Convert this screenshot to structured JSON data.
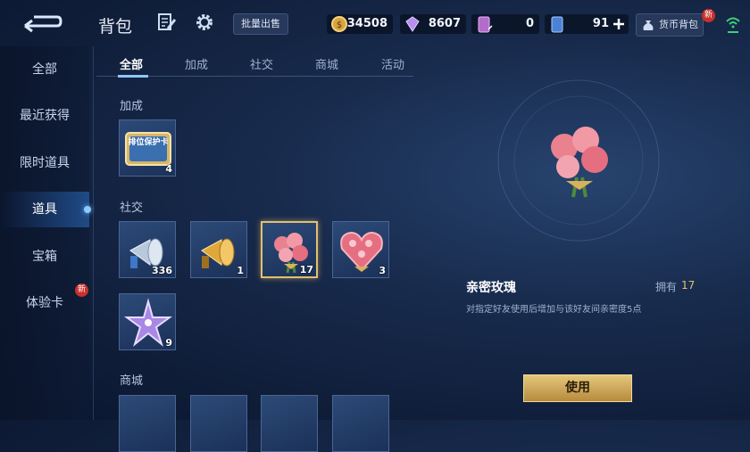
{
  "header": {
    "title": "背包",
    "batch_sell_label": "批量出售",
    "currencies": [
      {
        "icon": "gold-coin-icon",
        "value": "34508"
      },
      {
        "icon": "diamond-icon",
        "value": "8607"
      },
      {
        "icon": "ticket-card-icon",
        "value": "0"
      },
      {
        "icon": "voucher-card-icon",
        "value": "91"
      }
    ],
    "wallet_label": "货币背包",
    "wallet_badge": "新"
  },
  "sidebar": {
    "items": [
      {
        "label": "全部"
      },
      {
        "label": "最近获得"
      },
      {
        "label": "限时道具"
      },
      {
        "label": "道具"
      },
      {
        "label": "宝箱"
      },
      {
        "label": "体验卡",
        "badge": "新"
      }
    ],
    "active_index": 3
  },
  "tabs": [
    {
      "label": "全部"
    },
    {
      "label": "加成"
    },
    {
      "label": "社交"
    },
    {
      "label": "商城"
    },
    {
      "label": "活动"
    }
  ],
  "sections": [
    {
      "title": "加成",
      "items": [
        {
          "name": "ranking-protection-card",
          "icon_text": "排位保护卡",
          "count": "4"
        }
      ]
    },
    {
      "title": "社交",
      "items": [
        {
          "name": "silver-megaphone",
          "count": "336"
        },
        {
          "name": "gold-megaphone",
          "count": "1"
        },
        {
          "name": "intimate-rose",
          "count": "17"
        },
        {
          "name": "heart-roses",
          "count": "3"
        },
        {
          "name": "purple-star",
          "count": "9"
        }
      ]
    },
    {
      "title": "商城"
    }
  ],
  "detail": {
    "name": "亲密玫瑰",
    "owned_label": "拥有",
    "owned_value": "17",
    "description": "对指定好友使用后增加与该好友间亲密度5点",
    "use_label": "使用"
  },
  "colors": {
    "accent_gold": "#e2bf6e",
    "badge_red": "#c9302c",
    "active_blue": "#8ec8ff"
  }
}
